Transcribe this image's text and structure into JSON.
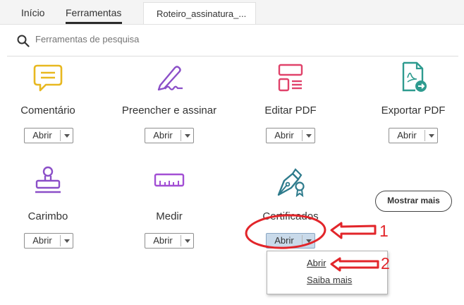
{
  "tabs": {
    "home": "Início",
    "tools": "Ferramentas",
    "document": "Roteiro_assinatura_..."
  },
  "search": {
    "placeholder": "Ferramentas de pesquisa"
  },
  "tools": [
    {
      "name": "Comentário",
      "open": "Abrir",
      "icon": "comment-icon"
    },
    {
      "name": "Preencher e assinar",
      "open": "Abrir",
      "icon": "fill-sign-icon"
    },
    {
      "name": "Editar PDF",
      "open": "Abrir",
      "icon": "edit-pdf-icon"
    },
    {
      "name": "Exportar PDF",
      "open": "Abrir",
      "icon": "export-pdf-icon"
    },
    {
      "name": "Carimbo",
      "open": "Abrir",
      "icon": "stamp-icon"
    },
    {
      "name": "Medir",
      "open": "Abrir",
      "icon": "ruler-icon"
    },
    {
      "name": "Certificados",
      "open": "Abrir",
      "icon": "certificate-pen-icon"
    }
  ],
  "more_button": "Mostrar mais",
  "dropdown": {
    "items": [
      "Abrir",
      "Saiba mais"
    ]
  },
  "annotations": {
    "label_1": "1",
    "label_2": "2",
    "color": "#e2252a"
  },
  "colors": {
    "comment": "#e8b820",
    "sign": "#8b4fc8",
    "edit": "#e0426a",
    "export": "#2e9b8f",
    "stamp": "#8b4fc8",
    "measure": "#a24fd4",
    "cert": "#2e7b8c"
  }
}
